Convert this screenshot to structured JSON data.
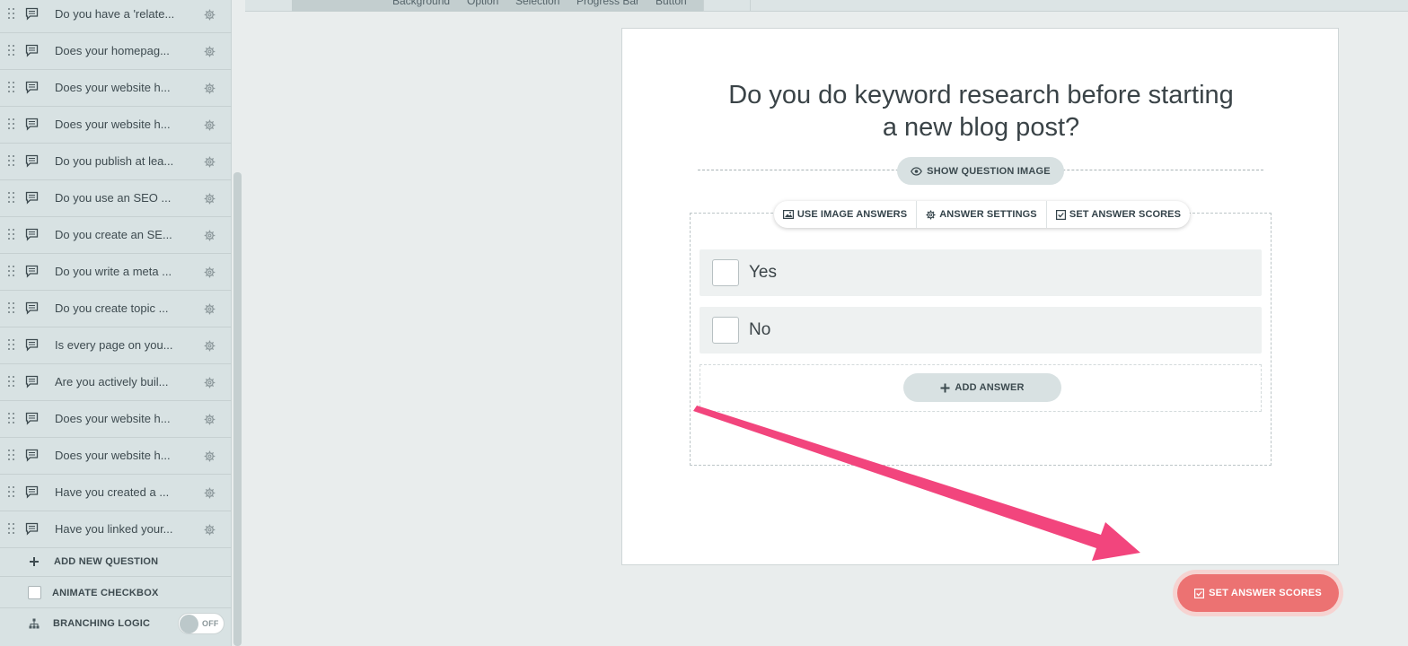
{
  "topbar": {
    "tabs": [
      "Background",
      "Option",
      "Selection",
      "Progress Bar",
      "Button"
    ]
  },
  "sidebar": {
    "questions": [
      "Do you have a 'relate...",
      "Does your homepag...",
      "Does your website h...",
      "Does your website h...",
      "Do you publish at lea...",
      "Do you use an SEO ...",
      "Do you create an SE...",
      "Do you write a meta ...",
      "Do you create topic ...",
      "Is every page on you...",
      "Are you actively buil...",
      "Does your website h...",
      "Does your website h...",
      "Have you created a ...",
      "Have you linked your..."
    ],
    "add_question": "ADD NEW QUESTION",
    "animate_checkbox": "ANIMATE CHECKBOX",
    "branching_logic": "BRANCHING LOGIC",
    "branching_toggle": "OFF"
  },
  "card": {
    "question_line1": "Do you do keyword research before starting",
    "question_line2": "a new blog post?",
    "show_image": "SHOW QUESTION IMAGE",
    "toolbar": {
      "image_answers": "USE IMAGE ANSWERS",
      "answer_settings": "ANSWER SETTINGS",
      "answer_scores": "SET ANSWER SCORES"
    },
    "answers": [
      "Yes",
      "No"
    ],
    "add_answer": "ADD ANSWER"
  },
  "floating_button": "SET ANSWER SCORES",
  "colors": {
    "sidebar_bg": "#d8e2e3",
    "accent_button": "#ec7272",
    "arrow": "#f2457d",
    "pill_bg": "#d8e1e2"
  },
  "icons": {
    "question": "speech-bubble-icon",
    "settings": "gear-icon",
    "drag": "drag-handle-icon",
    "eye": "eye-icon",
    "image": "image-icon",
    "check": "checkbox-check-icon",
    "plus": "plus-icon",
    "branch": "sitemap-icon"
  }
}
